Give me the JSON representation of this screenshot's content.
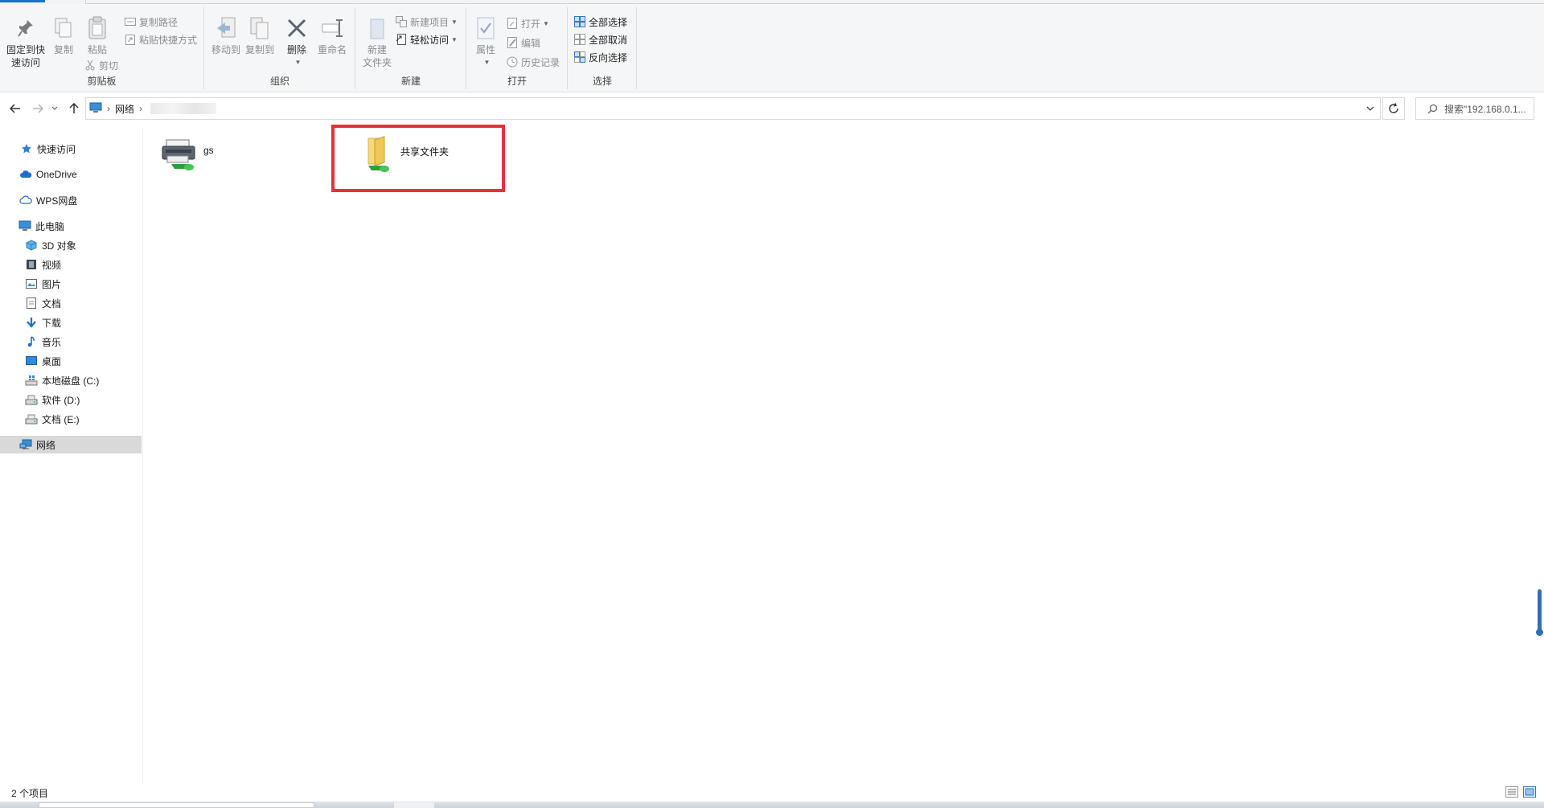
{
  "ribbon": {
    "clipboard": {
      "pin_label_line1": "固定到快",
      "pin_label_line2": "速访问",
      "copy_label": "复制",
      "paste_label": "粘贴",
      "copy_path_label": "复制路径",
      "paste_shortcut_label": "粘贴快捷方式",
      "cut_label": "剪切",
      "group_label": "剪贴板"
    },
    "organize": {
      "move_to_label": "移动到",
      "copy_to_label": "复制到",
      "delete_label": "删除",
      "rename_label": "重命名",
      "group_label": "组织"
    },
    "new": {
      "new_folder_line1": "新建",
      "new_folder_line2": "文件夹",
      "new_item_label": "新建项目",
      "easy_access_label": "轻松访问",
      "group_label": "新建"
    },
    "open": {
      "properties_label": "属性",
      "open_label": "打开",
      "edit_label": "编辑",
      "history_label": "历史记录",
      "group_label": "打开"
    },
    "select": {
      "select_all_label": "全部选择",
      "select_none_label": "全部取消",
      "invert_label": "反向选择",
      "group_label": "选择"
    }
  },
  "address": {
    "root_label": "网络",
    "search_placeholder": "搜索\"192.168.0.1..."
  },
  "sidebar": {
    "quick_access": "快速访问",
    "onedrive": "OneDrive",
    "wps_drive": "WPS网盘",
    "this_pc": "此电脑",
    "objects_3d": "3D 对象",
    "videos": "视频",
    "pictures": "图片",
    "documents": "文档",
    "downloads": "下载",
    "music": "音乐",
    "desktop": "桌面",
    "drive_c": "本地磁盘 (C:)",
    "drive_d": "软件 (D:)",
    "drive_e": "文档 (E:)",
    "network": "网络"
  },
  "content": {
    "items": [
      {
        "name": "gs",
        "type": "printer"
      },
      {
        "name": "共享文件夹",
        "type": "shared-folder"
      }
    ]
  },
  "status": {
    "item_count": "2 个项目"
  },
  "colors": {
    "accent": "#1a73c8",
    "highlight_border": "#e8303a",
    "selected_bg": "#d9d9d9"
  }
}
